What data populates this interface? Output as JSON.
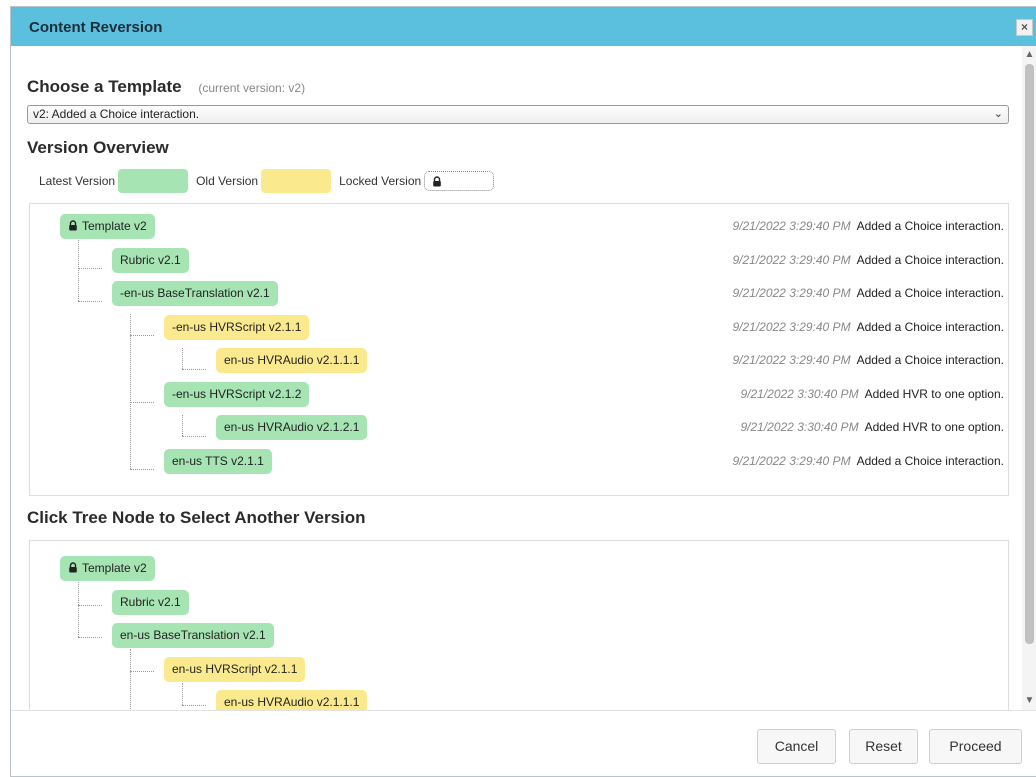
{
  "dialog": {
    "title": "Content Reversion",
    "close_glyph": "×"
  },
  "choose_template": {
    "heading": "Choose a Template",
    "current_version": "(current version: v2)",
    "selected": "v2: Added a Choice interaction."
  },
  "overview": {
    "heading": "Version Overview",
    "legend": {
      "latest": "Latest Version",
      "old": "Old Version",
      "locked": "Locked Version"
    }
  },
  "tree_rows": [
    {
      "label": "Template v2",
      "locked": true,
      "color": "green",
      "time": "9/21/2022 3:29:40 PM",
      "desc": "Added a Choice interaction."
    },
    {
      "label": "Rubric v2.1",
      "color": "green",
      "time": "9/21/2022 3:29:40 PM",
      "desc": "Added a Choice interaction."
    },
    {
      "label": "-en-us BaseTranslation v2.1",
      "color": "green",
      "time": "9/21/2022 3:29:40 PM",
      "desc": "Added a Choice interaction."
    },
    {
      "label": "-en-us HVRScript v2.1.1",
      "color": "yellow",
      "time": "9/21/2022 3:29:40 PM",
      "desc": "Added a Choice interaction."
    },
    {
      "label": "en-us HVRAudio v2.1.1.1",
      "color": "yellow",
      "time": "9/21/2022 3:29:40 PM",
      "desc": "Added a Choice interaction."
    },
    {
      "label": "-en-us HVRScript v2.1.2",
      "color": "green",
      "time": "9/21/2022 3:30:40 PM",
      "desc": "Added HVR to one option."
    },
    {
      "label": "en-us HVRAudio v2.1.2.1",
      "color": "green",
      "time": "9/21/2022 3:30:40 PM",
      "desc": "Added HVR to one option."
    },
    {
      "label": "en-us TTS v2.1.1",
      "color": "green",
      "time": "9/21/2022 3:29:40 PM",
      "desc": "Added a Choice interaction."
    }
  ],
  "select_section": {
    "heading": "Click Tree Node to Select Another Version",
    "nodes": [
      {
        "label": "Template v2",
        "locked": true,
        "color": "green"
      },
      {
        "label": "Rubric v2.1",
        "color": "green"
      },
      {
        "label": "en-us BaseTranslation v2.1",
        "color": "green"
      },
      {
        "label": "en-us HVRScript v2.1.1",
        "color": "yellow"
      },
      {
        "label": "en-us HVRAudio v2.1.1.1",
        "color": "yellow"
      }
    ]
  },
  "buttons": {
    "cancel": "Cancel",
    "reset": "Reset",
    "proceed": "Proceed"
  },
  "icons": {
    "lock": "lock-icon",
    "dropdown": "chevron-down-icon"
  },
  "colors": {
    "titlebar": "#5bc0de",
    "latest": "#a6e5b3",
    "old": "#fbea8d"
  }
}
